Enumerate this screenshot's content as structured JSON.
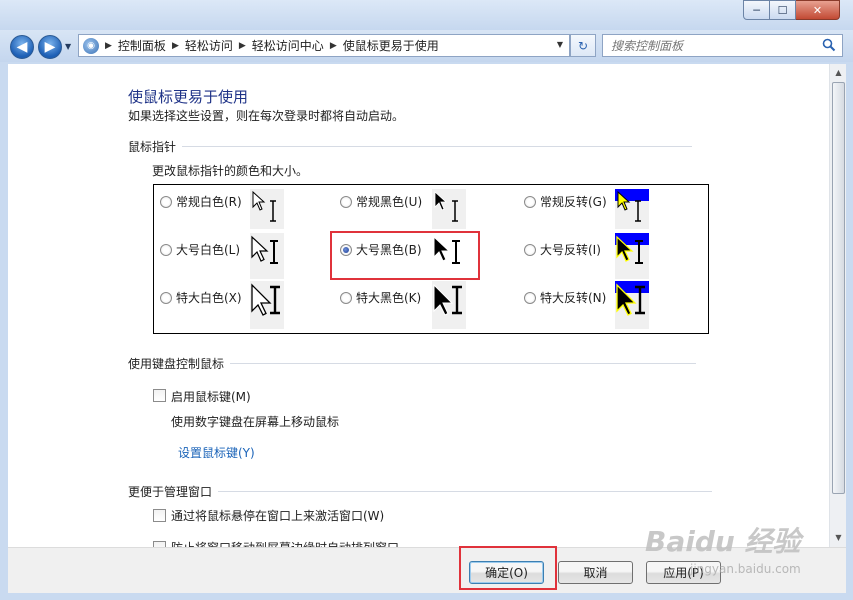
{
  "window": {
    "controls": {
      "minimize": "─",
      "maximize": "☐",
      "close": "✕"
    }
  },
  "nav": {
    "back": "◀",
    "forward": "▶",
    "dropdown": "▼",
    "breadcrumbs": [
      "控制面板",
      "轻松访问",
      "轻松访问中心",
      "使鼠标更易于使用"
    ],
    "address_dropdown": "▼",
    "refresh": "↻",
    "search_placeholder": "搜索控制面板"
  },
  "page": {
    "title": "使鼠标更易于使用",
    "subtitle": "如果选择这些设置，则在每次登录时都将自动启动。"
  },
  "pointers": {
    "section": "鼠标指针",
    "description": "更改鼠标指针的颜色和大小。",
    "selected": "大号黑色(B)",
    "schemes": [
      {
        "label": "常规白色(R)",
        "color": "white",
        "size": "normal",
        "checked": false
      },
      {
        "label": "常规黑色(U)",
        "color": "black",
        "size": "normal",
        "checked": false
      },
      {
        "label": "常规反转(G)",
        "color": "inverted",
        "size": "normal",
        "checked": false
      },
      {
        "label": "大号白色(L)",
        "color": "white",
        "size": "large",
        "checked": false
      },
      {
        "label": "大号黑色(B)",
        "color": "black",
        "size": "large",
        "checked": true
      },
      {
        "label": "大号反转(I)",
        "color": "inverted",
        "size": "large",
        "checked": false
      },
      {
        "label": "特大白色(X)",
        "color": "white",
        "size": "xlarge",
        "checked": false
      },
      {
        "label": "特大黑色(K)",
        "color": "black",
        "size": "xlarge",
        "checked": false
      },
      {
        "label": "特大反转(N)",
        "color": "inverted",
        "size": "xlarge",
        "checked": false
      }
    ]
  },
  "keyboard": {
    "section": "使用键盘控制鼠标",
    "mouse_keys_label": "启用鼠标键(M)",
    "mouse_keys_checked": false,
    "mouse_keys_desc": "使用数字键盘在屏幕上移动鼠标",
    "setup_link": "设置鼠标键(Y)"
  },
  "windows": {
    "section": "更便于管理窗口",
    "hover_activate_label": "通过将鼠标悬停在窗口上来激活窗口(W)",
    "hover_activate_checked": false,
    "snap_label": "防止将窗口移动到屏幕边缘时自动排列窗口",
    "snap_checked": false
  },
  "footer": {
    "ok": "确定(O)",
    "cancel": "取消",
    "apply": "应用(P)"
  },
  "scrollbar": {
    "up": "▲",
    "down": "▼"
  },
  "watermark": {
    "brand": "Baidu 经验",
    "url": "jingyan.baidu.com"
  },
  "colors": {
    "title": "#1e3287",
    "link": "#1a63b8",
    "highlight": "#e0323b",
    "inverted_bg": "#0000ff",
    "inverted_cursor": "#ffff00"
  }
}
